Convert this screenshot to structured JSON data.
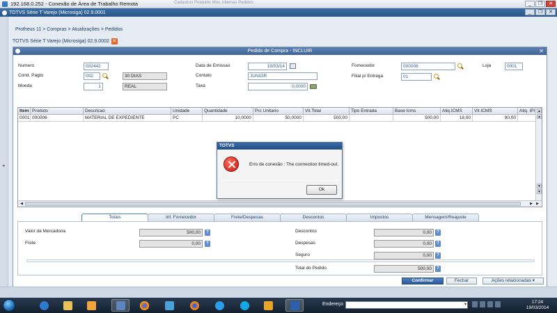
{
  "rdp": {
    "title": "192.168.0.252 - Conexão de Área de Trabalho Remota",
    "bg_toolbar": "Cadastros   Produtos   Mov. Internas   Pedidos"
  },
  "app": {
    "title": "TOTVS Série T Varejo (Microsiga) 02.9.0001"
  },
  "breadcrumb": "Protheus 11  >  Compras  >  Atualizações  >  Pedidos",
  "doc_tab": {
    "label": "TOTVS Série T Varejo (Microsiga) 02.9.0002"
  },
  "dialog": {
    "title": "Pedido de Compra - INCLUIR"
  },
  "header": {
    "numero": {
      "label": "Numero",
      "value": "002442"
    },
    "cond_pagto": {
      "label": "Cond. Pagto",
      "value": "002",
      "desc": "30 DIAS"
    },
    "moeda": {
      "label": "Moeda",
      "value": "1",
      "desc": "REAL"
    },
    "data_emissao": {
      "label": "Data de Emissao",
      "value": "19/03/14"
    },
    "contato": {
      "label": "Contato",
      "value": "JUNIOR"
    },
    "taxa": {
      "label": "Taxa",
      "value": "0,0000"
    },
    "fornecedor": {
      "label": "Fornecedor",
      "value": "000006"
    },
    "loja": {
      "label": "Loja",
      "value": "0001"
    },
    "filial_entrega": {
      "label": "Filial p/ Entrega",
      "value": "01"
    }
  },
  "grid": {
    "columns": [
      "Item",
      "Produto",
      "Descricao",
      "Unidade",
      "Quantidade",
      "Prc Unitario",
      "Vlr.Total",
      "Tipo Entrada",
      "Base Icms",
      "Aliq.ICMS",
      "Vlr.ICMS",
      "Aliq. IPI"
    ],
    "rows": [
      [
        "0001",
        "000006",
        "MATERIAL DE EXPEDIENTE",
        "PC",
        "10,0000",
        "50,0000",
        "500,00",
        "",
        "500,00",
        "18,00",
        "90,00",
        ""
      ]
    ]
  },
  "tabs": [
    {
      "label": "Totais",
      "active": true
    },
    {
      "label": "Inf. Fornecedor",
      "active": false
    },
    {
      "label": "Frete/Despesas",
      "active": false
    },
    {
      "label": "Descontos",
      "active": false
    },
    {
      "label": "Impostos",
      "active": false
    },
    {
      "label": "Mensagem/Reajuste",
      "active": false
    }
  ],
  "totals": {
    "valor_mercadoria": {
      "label": "Valor da Mercadoria",
      "value": "500,00"
    },
    "frete": {
      "label": "Frete",
      "value": "0,00"
    },
    "descontos": {
      "label": "Descontos",
      "value": "0,00"
    },
    "despesas": {
      "label": "Despesas",
      "value": "0,00"
    },
    "seguro": {
      "label": "Seguro",
      "value": "0,00"
    },
    "total_pedido": {
      "label": "Total do Pedido",
      "value": "500,00"
    }
  },
  "buttons": {
    "confirmar": "Confirmar",
    "fechar": "Fechar",
    "acoes": "Ações relacionadas"
  },
  "modal": {
    "title": "TOTVS",
    "message": "Erro de conexão : The connection timed-out.",
    "ok": "Ok"
  },
  "taskbar": {
    "address_label": "Endereço",
    "time": "17:24",
    "date": "19/03/2014"
  },
  "colors": {
    "accent": "#2a5589",
    "field_text": "#2d5d9c",
    "error": "#c3170c"
  },
  "icons": [
    "rdp-icon",
    "search-icon",
    "calendar-icon",
    "calculator-icon",
    "error-icon",
    "help-icon",
    "start-orb"
  ]
}
